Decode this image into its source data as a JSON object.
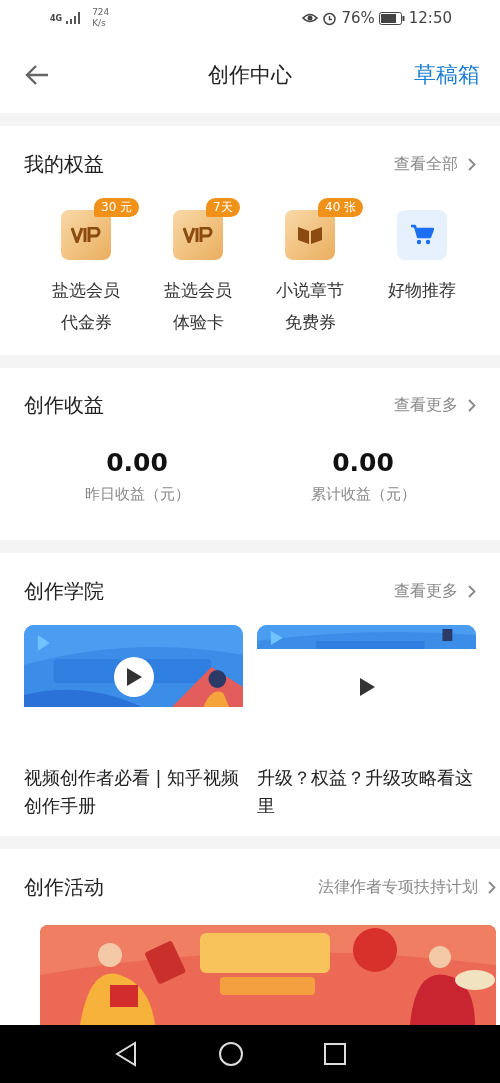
{
  "status_bar": {
    "network": "4G",
    "speed": "724",
    "speed_unit": "K/s",
    "battery": "76%",
    "time": "12:50"
  },
  "header": {
    "title": "创作中心",
    "action": "草稿箱"
  },
  "benefits": {
    "title": "我的权益",
    "link": "查看全部",
    "items": [
      {
        "kind": "vip",
        "badge": "30 元",
        "label": "盐选会员代金券"
      },
      {
        "kind": "vip",
        "badge": "7天",
        "label": "盐选会员体验卡"
      },
      {
        "kind": "book",
        "badge": "40 张",
        "label": "小说章节免费券"
      },
      {
        "kind": "cart",
        "label": "好物推荐"
      }
    ]
  },
  "earnings": {
    "title": "创作收益",
    "link": "查看更多",
    "items": [
      {
        "value": "0.00",
        "label": "昨日收益（元）"
      },
      {
        "value": "0.00",
        "label": "累计收益（元）"
      }
    ]
  },
  "academy": {
    "title": "创作学院",
    "link": "查看更多",
    "videos": [
      {
        "kind": "picture",
        "title": "视频创作者必看 | 知乎视频创作手册"
      },
      {
        "kind": "partial",
        "title": "升级？权益？升级攻略看这里"
      }
    ]
  },
  "activities": {
    "title": "创作活动",
    "link": "法律作者专项扶持计划"
  }
}
